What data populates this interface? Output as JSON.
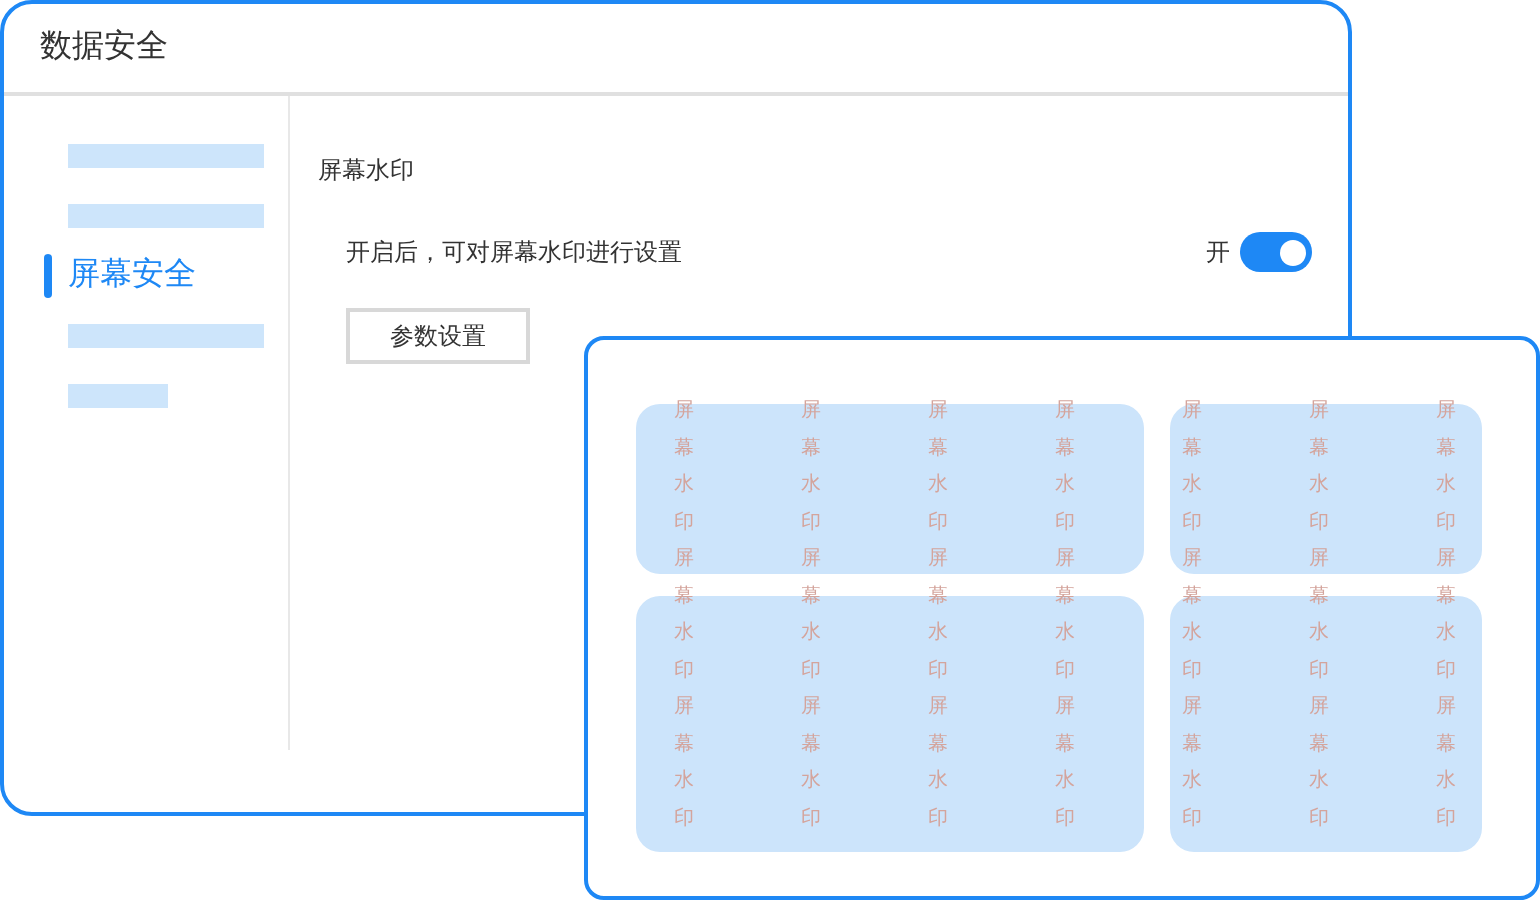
{
  "window": {
    "title": "数据安全"
  },
  "sidebar": {
    "items": [
      {
        "kind": "placeholder",
        "short": false,
        "selected": false
      },
      {
        "kind": "placeholder",
        "short": false,
        "selected": false
      },
      {
        "kind": "link",
        "label": "屏幕安全",
        "selected": true
      },
      {
        "kind": "placeholder",
        "short": false,
        "selected": false
      },
      {
        "kind": "placeholder",
        "short": true,
        "selected": false
      }
    ]
  },
  "section": {
    "title": "屏幕水印",
    "setting": {
      "label": "开启后，可对屏幕水印进行设置",
      "state_label": "开",
      "on": true
    },
    "button": "参数设置"
  },
  "preview": {
    "watermark_columns": [
      "屏幕水印屏幕水印屏幕水印",
      "屏幕水印屏幕水印屏幕水印",
      "屏幕水印屏幕水印屏幕水印",
      "屏幕水印屏幕水印屏幕水印",
      "屏幕水印屏幕水印屏幕水印",
      "屏幕水印屏幕水印屏幕水印",
      "屏幕水印屏幕水印屏幕水印"
    ]
  }
}
